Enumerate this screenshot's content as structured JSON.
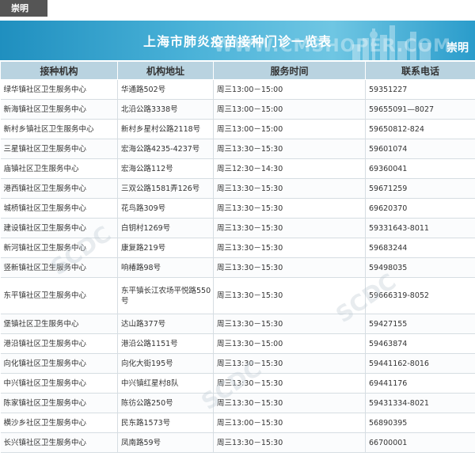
{
  "region_tab": "崇明",
  "banner": {
    "title": "上海市肺炎疫苗接种门诊一览表",
    "watermark": "WWW.CMSHOPER.COM",
    "region": "崇明"
  },
  "table": {
    "headers": [
      "接种机构",
      "机构地址",
      "服务时间",
      "联系电话"
    ],
    "rows": [
      {
        "org": "绿华镇社区卫生服务中心",
        "addr": "华通路502号",
        "time": "周三13:00－15:00",
        "phone": "59351227"
      },
      {
        "org": "新海镇社区卫生服务中心",
        "addr": "北沿公路3338号",
        "time": "周三13:00－15:00",
        "phone": "59655091—8027"
      },
      {
        "org": "新村乡镇社区卫生服务中心",
        "addr": "新村乡星村公路2118号",
        "time": "周三13:00－15:00",
        "phone": "59650812-824"
      },
      {
        "org": "三星镇社区卫生服务中心",
        "addr": "宏海公路4235-4237号",
        "time": "周三13:30－15:30",
        "phone": "59601074"
      },
      {
        "org": "庙镇社区卫生服务中心",
        "addr": "宏海公路112号",
        "time": "周三12:30－14:30",
        "phone": "69360041"
      },
      {
        "org": "港西镇社区卫生服务中心",
        "addr": "三双公路1581弄126号",
        "time": "周三13:30－15:30",
        "phone": "59671259"
      },
      {
        "org": "城桥镇社区卫生服务中心",
        "addr": "花鸟路309号",
        "time": "周三13:30－15:30",
        "phone": "69620370"
      },
      {
        "org": "建设镇社区卫生服务中心",
        "addr": "白钥村1269号",
        "time": "周三13:30－15:30",
        "phone": "59331643-8011"
      },
      {
        "org": "新河镇社区卫生服务中心",
        "addr": "康复路219号",
        "time": "周三13:30－15:30",
        "phone": "59683244"
      },
      {
        "org": "竖新镇社区卫生服务中心",
        "addr": "响椿路98号",
        "time": "周三13:30－15:30",
        "phone": "59498035"
      },
      {
        "org": "东平镇社区卫生服务中心",
        "addr": "东平镇长江农场平悦路550号",
        "time": "周三13:30－15:30",
        "phone": "59666319-8052",
        "tall": true
      },
      {
        "org": "堡镇社区卫生服务中心",
        "addr": "达山路377号",
        "time": "周三13:30－15:30",
        "phone": "59427155"
      },
      {
        "org": "港沿镇社区卫生服务中心",
        "addr": "港沿公路1151号",
        "time": "周三13:30－15:00",
        "phone": "59463874"
      },
      {
        "org": "向化镇社区卫生服务中心",
        "addr": "向化大街195号",
        "time": "周三13:30－15:30",
        "phone": "59441162-8016"
      },
      {
        "org": "中兴镇社区卫生服务中心",
        "addr": "中兴镇红星村8队",
        "time": "周三13:30－15:30",
        "phone": "69441176"
      },
      {
        "org": "陈家镇社区卫生服务中心",
        "addr": "陈彷公路250号",
        "time": "周三13:30－15:30",
        "phone": "59431334-8021"
      },
      {
        "org": "横沙乡社区卫生服务中心",
        "addr": "民东路1573号",
        "time": "周三13:00－15:30",
        "phone": "56890395"
      },
      {
        "org": "长兴镇社区卫生服务中心",
        "addr": "凤南路59号",
        "time": "周三13:30－15:30",
        "phone": "66700001"
      }
    ]
  }
}
